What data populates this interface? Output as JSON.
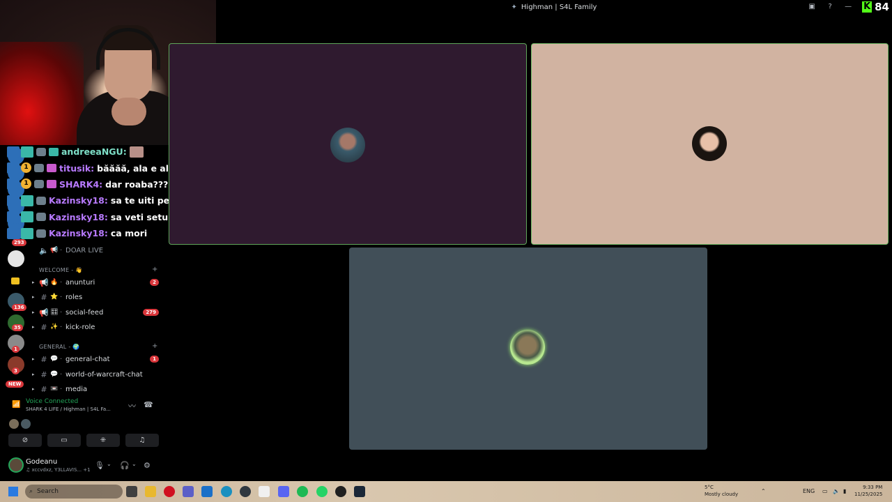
{
  "window": {
    "title": "Highman | S4L Family",
    "kick_viewers": "84"
  },
  "chat": [
    {
      "user": "andreeaNGU:",
      "message": "",
      "color": "#7ee0c8",
      "badge": "teal",
      "has_emote": true
    },
    {
      "user": "titusik:",
      "message": "băăăă, ala e al meu",
      "color": "#b87aff",
      "badge": "gold",
      "has_emote": false
    },
    {
      "user": "SHARK4:",
      "message": "dar roaba???",
      "color": "#b87aff",
      "badge": "gold",
      "has_emote": false
    },
    {
      "user": "Kazinsky18:",
      "message": "sa te uiti pe NSFW",
      "color": "#b87aff",
      "badge": "teal",
      "has_emote": false
    },
    {
      "user": "Kazinsky18:",
      "message": "sa veti setup",
      "color": "#b87aff",
      "badge": "teal",
      "has_emote": false
    },
    {
      "user": "Kazinsky18:",
      "message": "ca mori",
      "color": "#b87aff",
      "badge": "teal",
      "has_emote": false
    }
  ],
  "rail": {
    "badges": [
      "293",
      "136",
      "35",
      "1",
      "3"
    ],
    "new_label": "NEW"
  },
  "sidebar": {
    "doar_live": "DOAR LIVE",
    "cat_welcome": "WELCOME - 👋",
    "cat_general": "GENERAL - 🌍",
    "channels": [
      {
        "name": "anunturi",
        "count": "2",
        "emoji": "🔥"
      },
      {
        "name": "roles",
        "count": "",
        "emoji": "⭐"
      },
      {
        "name": "social-feed",
        "count": "279",
        "emoji": "🎛"
      },
      {
        "name": "kick-role",
        "count": "",
        "emoji": "✨"
      },
      {
        "name": "general-chat",
        "count": "1",
        "emoji": "💬"
      },
      {
        "name": "world-of-warcraft-chat",
        "count": "",
        "emoji": "💬"
      },
      {
        "name": "media",
        "count": "",
        "emoji": "📼"
      }
    ]
  },
  "voice": {
    "status": "Voice Connected",
    "location": "SHARK 4 LIFE / Highman | S4L Fa..."
  },
  "user": {
    "name": "Godeanu",
    "sub": "♫ xccvdxz, Y3LLAVIS... +1"
  },
  "taskbar": {
    "search": "Search",
    "temp": "5°C",
    "weather": "Mostly cloudy",
    "lang": "ENG",
    "time": "9:33 PM",
    "date": "11/25/2025"
  },
  "colors": {
    "speaking_border": "#5fa65a",
    "tile1_bg": "#2f1a2f",
    "tile2_bg": "#d1b3a1",
    "tile3_bg": "#414f58",
    "kick_green": "#53fc18"
  }
}
